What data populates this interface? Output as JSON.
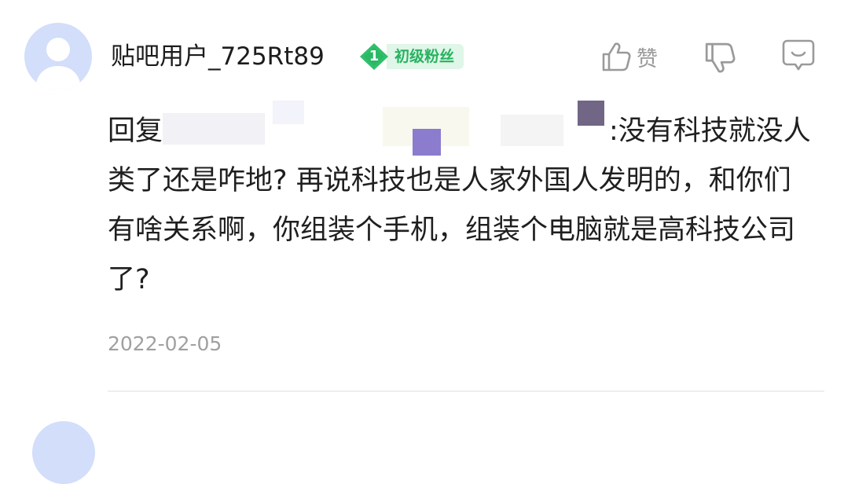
{
  "comment": {
    "username": "贴吧用户_725Rt89",
    "level": {
      "number": "1",
      "label": "初级粉丝",
      "color": "#27b25f"
    },
    "actions": {
      "like_label": "赞",
      "like_icon": "thumbs-up-icon",
      "dislike_icon": "thumbs-down-icon",
      "reply_icon": "reply-icon"
    },
    "body": {
      "prefix": "回复",
      "rest": ":没有科技就没人类了还是咋地? 再说科技也是人家外国人发明的，和你们有啥关系啊，你组装个手机，组装个电脑就是高科技公司了?"
    },
    "date": "2022-02-05"
  },
  "colors": {
    "accent_green": "#27b25f",
    "avatar_bg": "#d2defa",
    "icon_gray": "#9a9a9a"
  }
}
